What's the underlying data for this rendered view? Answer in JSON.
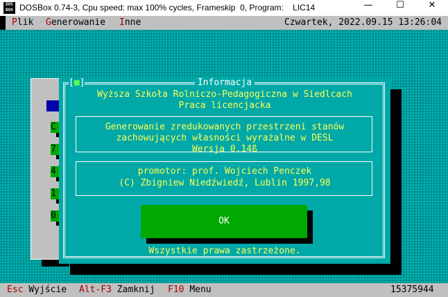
{
  "window": {
    "icon_label": "DOS\nBOX",
    "title": "DOSBox 0.74-3, Cpu speed: max 100% cycles, Frameskip  0, Program:    LIC14"
  },
  "menubar": {
    "items": [
      {
        "hotkey": "P",
        "rest": "lik"
      },
      {
        "hotkey": "G",
        "rest": "enerowanie"
      },
      {
        "hotkey": "I",
        "rest": "nne"
      }
    ],
    "datetime": "Czwartek, 2022.09.15 13:26:04"
  },
  "background_window": {
    "buttons": [
      "C",
      "7",
      "4",
      "1",
      "0"
    ]
  },
  "dialog": {
    "close_symbol": "[■]",
    "title": "Informacja",
    "header_line1": "Wyższa Szkoła Rolniczo-Pedagogiczna w Siedlcach",
    "header_line2": "Praca licencjacka",
    "box1_line1": "Generowanie zredukowanych przestrzeni stanów",
    "box1_line2": "zachowujących własności wyrażalne w DESL",
    "box1_line3": "Wersja 0.14ß",
    "box2_line1": "promotor: prof. Wojciech Penczek",
    "box2_line2": "(C) Zbigniew Niedźwiedź, Lublin 1997,98",
    "ok_label": "OK",
    "footer": "Wszystkie prawa zastrzeżone."
  },
  "statusbar": {
    "items": [
      {
        "key": "Esc",
        "label": "Wyjście"
      },
      {
        "key": "Alt-F3",
        "label": "Zamknij"
      },
      {
        "key": "F10",
        "label": "Menu"
      }
    ],
    "memory": "15375944"
  },
  "colors": {
    "desktop": "#00a8a8",
    "bars": "#c0c0c0",
    "hotkey": "#a80000",
    "dialog_text": "#ffff55",
    "ok_button": "#00a800"
  }
}
